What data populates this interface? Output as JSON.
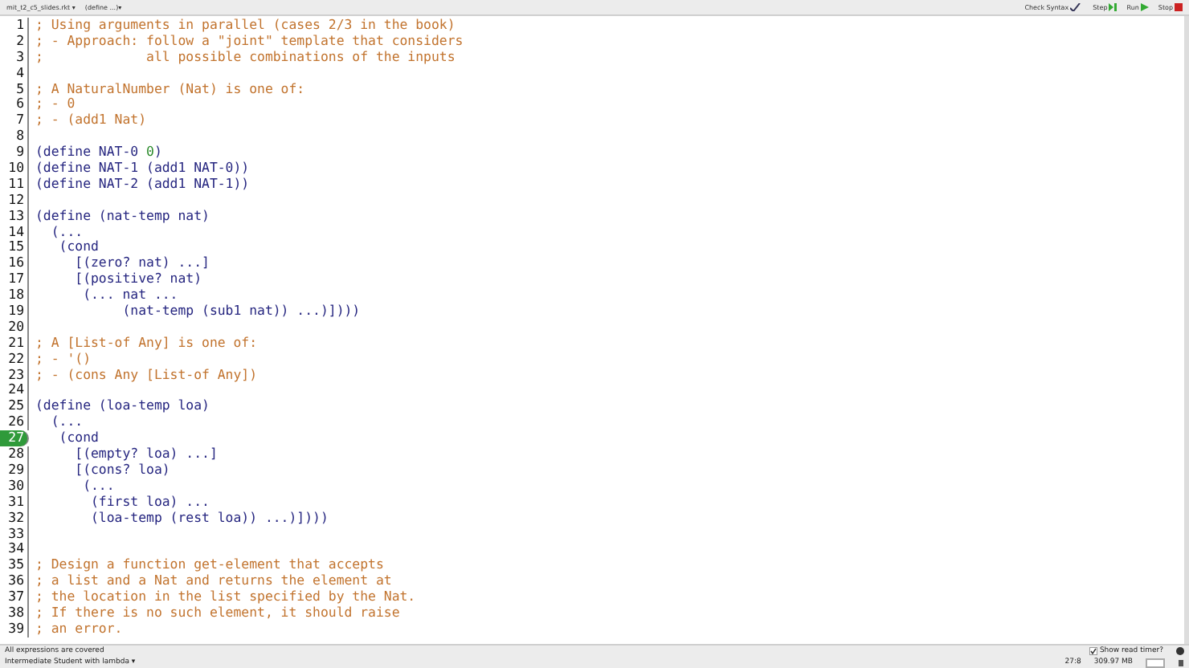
{
  "toolbar": {
    "file_menu": "mit_t2_c5_slides.rkt ▾",
    "define_menu": "(define ...)▾",
    "buttons": [
      {
        "label": "Check Syntax",
        "kind": "check"
      },
      {
        "label": "Step",
        "kind": "step"
      },
      {
        "label": "Run",
        "kind": "run"
      },
      {
        "label": "Stop",
        "kind": "stop"
      }
    ]
  },
  "editor": {
    "lines": [
      {
        "number": "1",
        "current": false,
        "tokens": [
          {
            "text": "; Using arguments in parallel (cases 2/3 in the book)",
            "kind": "comment"
          }
        ]
      },
      {
        "number": "2",
        "current": false,
        "tokens": [
          {
            "text": "; - Approach: follow a \"joint\" template that considers",
            "kind": "comment"
          }
        ]
      },
      {
        "number": "3",
        "current": false,
        "tokens": [
          {
            "text": ";             all possible combinations of the inputs",
            "kind": "comment"
          }
        ]
      },
      {
        "number": "4",
        "current": false
      },
      {
        "number": "5",
        "current": false,
        "tokens": [
          {
            "text": "; A NaturalNumber (Nat) is one of:",
            "kind": "comment"
          }
        ]
      },
      {
        "number": "6",
        "current": false,
        "tokens": [
          {
            "text": "; - 0",
            "kind": "comment"
          }
        ]
      },
      {
        "number": "7",
        "current": false,
        "tokens": [
          {
            "text": "; - (add1 Nat)",
            "kind": "comment"
          }
        ]
      },
      {
        "number": "8",
        "current": false
      },
      {
        "number": "9",
        "current": false,
        "tokens": [
          {
            "text": "(define NAT-0 ",
            "kind": "code"
          },
          {
            "text": "0",
            "kind": "number"
          },
          {
            "text": ")",
            "kind": "code"
          }
        ]
      },
      {
        "number": "10",
        "current": false,
        "tokens": [
          {
            "text": "(define NAT-1 (add1 NAT-0))",
            "kind": "code"
          }
        ]
      },
      {
        "number": "11",
        "current": false,
        "tokens": [
          {
            "text": "(define NAT-2 (add1 NAT-1))",
            "kind": "code"
          }
        ]
      },
      {
        "number": "12",
        "current": false
      },
      {
        "number": "13",
        "current": false,
        "tokens": [
          {
            "text": "(define (nat-temp nat)",
            "kind": "code"
          }
        ]
      },
      {
        "number": "14",
        "current": false,
        "tokens": [
          {
            "text": "  (...",
            "kind": "code"
          }
        ]
      },
      {
        "number": "15",
        "current": false,
        "tokens": [
          {
            "text": "   (cond",
            "kind": "code"
          }
        ]
      },
      {
        "number": "16",
        "current": false,
        "tokens": [
          {
            "text": "     [(zero? nat) ...]",
            "kind": "code"
          }
        ]
      },
      {
        "number": "17",
        "current": false,
        "tokens": [
          {
            "text": "     [(positive? nat)",
            "kind": "code"
          }
        ]
      },
      {
        "number": "18",
        "current": false,
        "tokens": [
          {
            "text": "      (... nat ...",
            "kind": "code"
          }
        ]
      },
      {
        "number": "19",
        "current": false,
        "tokens": [
          {
            "text": "           (nat-temp (sub1 nat)) ...)])))",
            "kind": "code"
          }
        ]
      },
      {
        "number": "20",
        "current": false
      },
      {
        "number": "21",
        "current": false,
        "tokens": [
          {
            "text": "; A [List-of Any] is one of:",
            "kind": "comment"
          }
        ]
      },
      {
        "number": "22",
        "current": false,
        "tokens": [
          {
            "text": "; - '()",
            "kind": "comment"
          }
        ]
      },
      {
        "number": "23",
        "current": false,
        "tokens": [
          {
            "text": "; - (cons Any [List-of Any])",
            "kind": "comment"
          }
        ]
      },
      {
        "number": "24",
        "current": false
      },
      {
        "number": "25",
        "current": false,
        "tokens": [
          {
            "text": "(define (loa-temp loa)",
            "kind": "code"
          }
        ]
      },
      {
        "number": "26",
        "current": false,
        "tokens": [
          {
            "text": "  (...",
            "kind": "code"
          }
        ]
      },
      {
        "number": "27",
        "current": true,
        "tokens": [
          {
            "text": "   (cond",
            "kind": "code"
          }
        ]
      },
      {
        "number": "28",
        "current": false,
        "tokens": [
          {
            "text": "     [(empty? loa) ...]",
            "kind": "code"
          }
        ]
      },
      {
        "number": "29",
        "current": false,
        "tokens": [
          {
            "text": "     [(cons? loa)",
            "kind": "code"
          }
        ]
      },
      {
        "number": "30",
        "current": false,
        "tokens": [
          {
            "text": "      (...",
            "kind": "code"
          }
        ]
      },
      {
        "number": "31",
        "current": false,
        "tokens": [
          {
            "text": "       (first loa) ...",
            "kind": "code"
          }
        ]
      },
      {
        "number": "32",
        "current": false,
        "tokens": [
          {
            "text": "       (loa-temp (rest loa)) ...)])))",
            "kind": "code"
          }
        ]
      },
      {
        "number": "33",
        "current": false
      },
      {
        "number": "34",
        "current": false
      },
      {
        "number": "35",
        "current": false,
        "tokens": [
          {
            "text": "; Design a function get-element that accepts",
            "kind": "comment"
          }
        ]
      },
      {
        "number": "36",
        "current": false,
        "tokens": [
          {
            "text": "; a list and a Nat and returns the element at",
            "kind": "comment"
          }
        ]
      },
      {
        "number": "37",
        "current": false,
        "tokens": [
          {
            "text": "; the location in the list specified by the Nat.",
            "kind": "comment"
          }
        ]
      },
      {
        "number": "38",
        "current": false,
        "tokens": [
          {
            "text": "; If there is no such element, it should raise",
            "kind": "comment"
          }
        ]
      },
      {
        "number": "39",
        "current": false,
        "tokens": [
          {
            "text": "; an error.",
            "kind": "comment"
          }
        ]
      }
    ]
  },
  "status": {
    "message": "All expressions are covered",
    "read_timer": {
      "label": "Show read timer?",
      "checked": true
    },
    "language": "Intermediate Student with lambda ▾",
    "position": "27:8",
    "memory": "309.97 MB"
  }
}
